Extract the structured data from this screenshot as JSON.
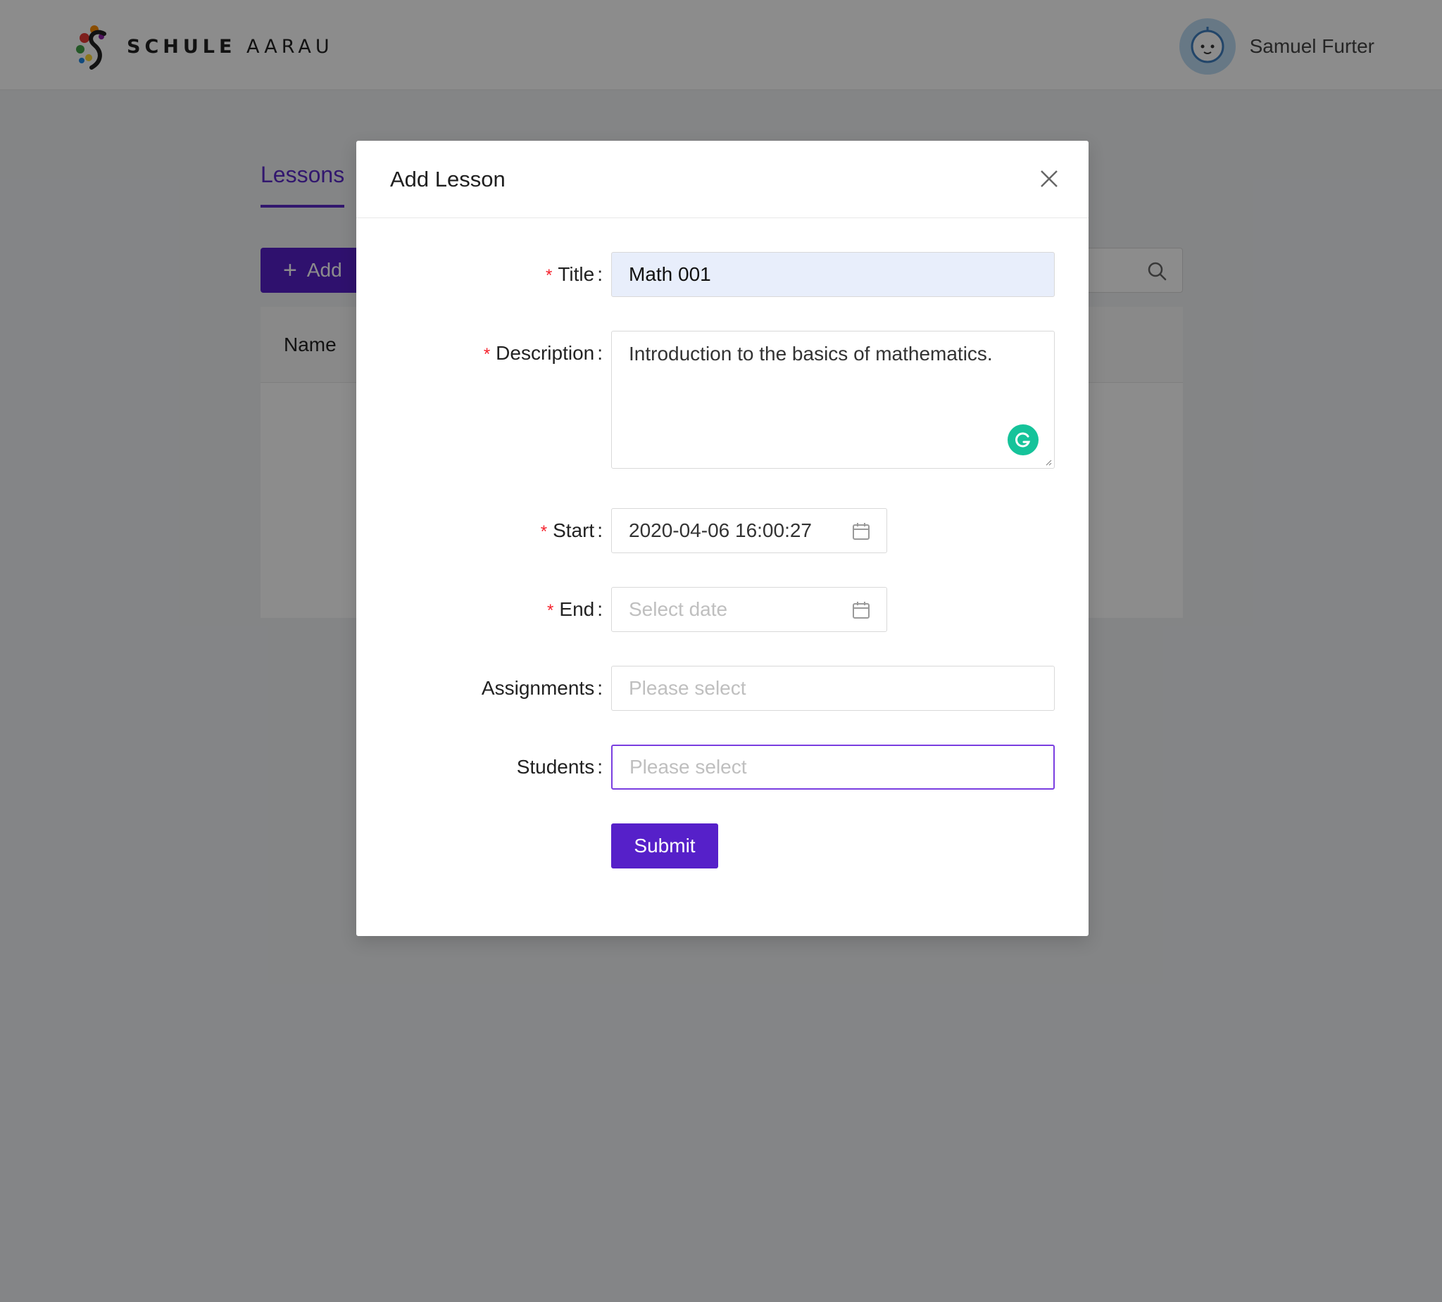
{
  "header": {
    "logo_text_bold": "SCHULE",
    "logo_text_light": "AARAU",
    "user_name": "Samuel Furter"
  },
  "page": {
    "tab_active": "Lessons",
    "add_button_label": "Add",
    "table_header_name": "Name"
  },
  "modal": {
    "title": "Add Lesson",
    "fields": {
      "title": {
        "label": "Title",
        "value": "Math 001",
        "required": true
      },
      "description": {
        "label": "Description",
        "value": "Introduction to the basics of mathematics.",
        "required": true
      },
      "start": {
        "label": "Start",
        "value": "2020-04-06 16:00:27",
        "required": true
      },
      "end": {
        "label": "End",
        "placeholder": "Select date",
        "required": true
      },
      "assignments": {
        "label": "Assignments",
        "placeholder": "Please select"
      },
      "students": {
        "label": "Students",
        "placeholder": "Please select"
      }
    },
    "submit_label": "Submit"
  },
  "colors": {
    "primary": "#5620c9",
    "required_mark": "#f5222d",
    "overlay": "rgba(0,0,0,0.45)"
  }
}
